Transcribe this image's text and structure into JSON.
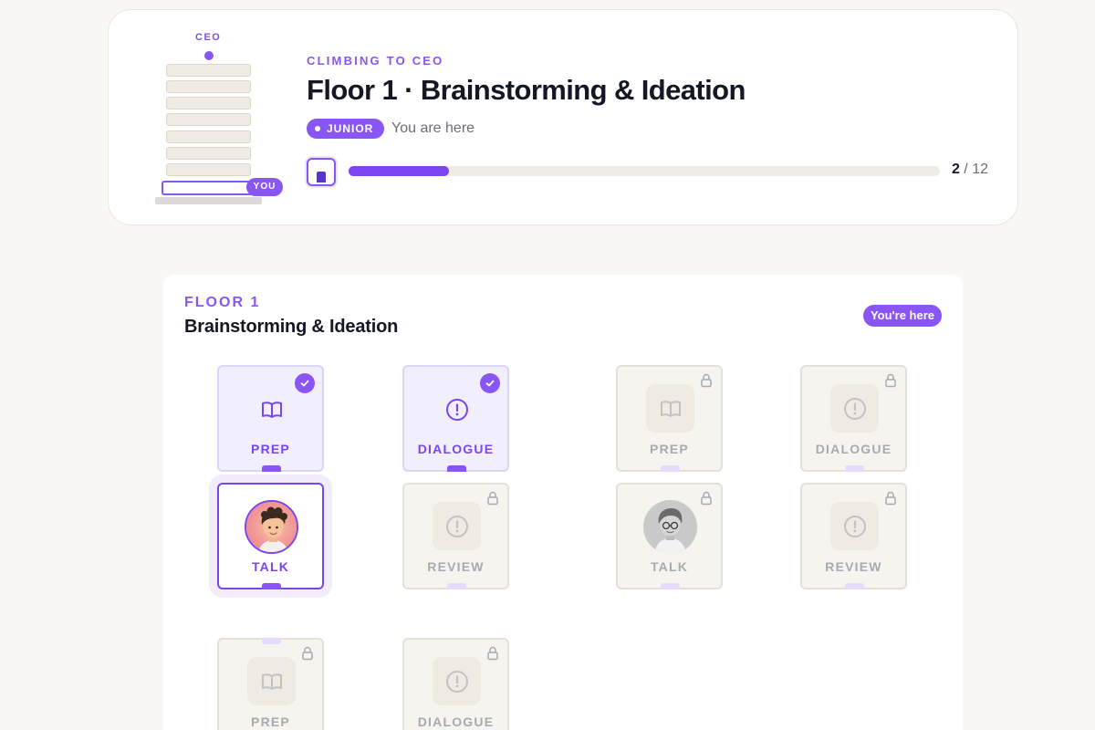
{
  "header": {
    "tower": {
      "top_label": "CEO",
      "you_badge": "YOU"
    },
    "kicker": "CLIMBING TO CEO",
    "title": "Floor 1 · Brainstorming & Ideation",
    "level_badge": "JUNIOR",
    "location_text": "You are here",
    "progress": {
      "current": "2",
      "total": "12",
      "separator": "/",
      "fraction": 0.17
    }
  },
  "floor": {
    "label": "FLOOR 1",
    "name": "Brainstorming & Ideation",
    "status_badge": "You're here"
  },
  "nodes": {
    "row1": [
      {
        "label": "PREP",
        "state": "completed",
        "icon": "book-icon"
      },
      {
        "label": "DIALOGUE",
        "state": "completed",
        "icon": "exclamation-circle-icon"
      },
      {
        "label": "PREP",
        "state": "locked",
        "icon": "book-icon"
      },
      {
        "label": "DIALOGUE",
        "state": "locked",
        "icon": "exclamation-circle-icon"
      }
    ],
    "row2": [
      {
        "label": "TALK",
        "state": "current",
        "icon": "avatar-character"
      },
      {
        "label": "REVIEW",
        "state": "locked",
        "icon": "exclamation-circle-icon"
      },
      {
        "label": "TALK",
        "state": "locked",
        "icon": "avatar-character-grayscale"
      },
      {
        "label": "REVIEW",
        "state": "locked",
        "icon": "exclamation-circle-icon"
      }
    ],
    "row3": [
      {
        "label": "PREP",
        "state": "locked",
        "icon": "book-icon"
      },
      {
        "label": "DIALOGUE",
        "state": "locked",
        "icon": "exclamation-circle-icon"
      }
    ]
  },
  "colors": {
    "accent": "#8a55f5",
    "accent_dark": "#7a45ee",
    "background": "#f8f7f4",
    "locked": "#a9aab0"
  }
}
